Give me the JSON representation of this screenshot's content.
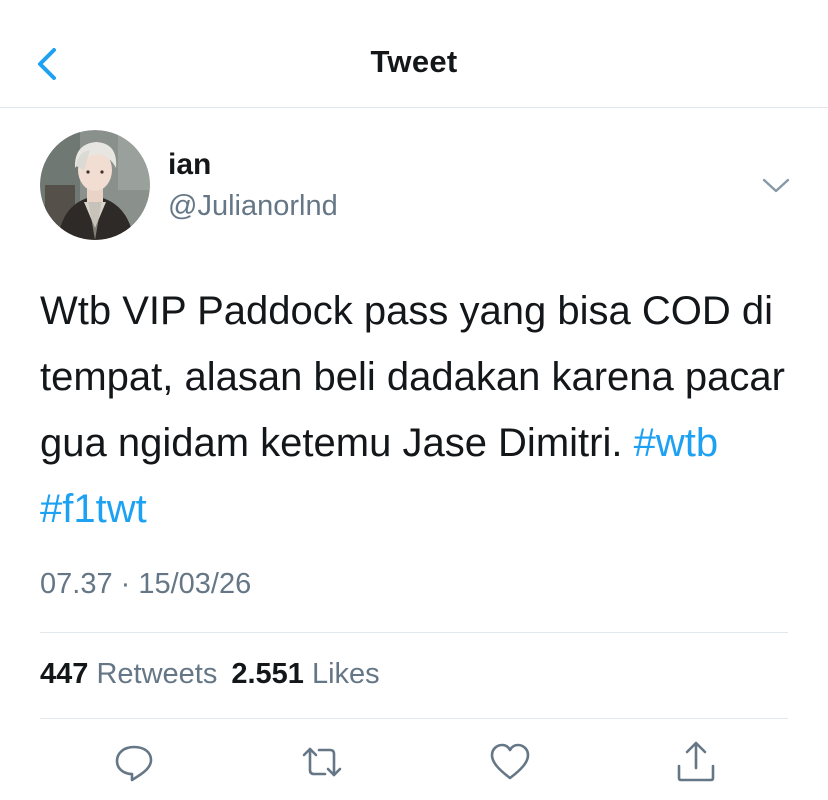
{
  "header": {
    "title": "Tweet",
    "back_icon": "chevron-left-icon"
  },
  "author": {
    "display_name": "ian",
    "handle": "@Julianorlnd",
    "avatar_icon": "avatar-photo"
  },
  "tweet": {
    "text": "Wtb VIP Paddock pass yang bisa COD di tempat, alasan beli dadakan karena pacar gua ngidam ketemu Jase Dimitri. ",
    "hashtags": [
      "#wtb",
      "#f1twt"
    ],
    "timestamp": "07.37 · 15/03/26"
  },
  "stats": {
    "retweets_count": "447",
    "retweets_label": "Retweets",
    "likes_count": "2.551",
    "likes_label": "Likes"
  },
  "actions": {
    "reply_icon": "reply-icon",
    "retweet_icon": "retweet-icon",
    "like_icon": "heart-icon",
    "share_icon": "share-icon"
  },
  "colors": {
    "accent": "#1da1f2",
    "text": "#14171a",
    "secondary_text": "#657786",
    "divider": "#e1e8ed"
  }
}
